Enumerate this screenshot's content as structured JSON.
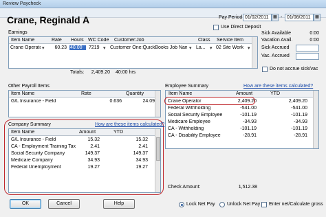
{
  "window": {
    "title": "Review Paycheck"
  },
  "employee": {
    "name": "Crane, Reginald A"
  },
  "pay_period": {
    "label": "Pay Period",
    "start": "01/02/2011",
    "dash": "-",
    "end": "01/08/2011",
    "direct_deposit_label": "Use Direct Deposit"
  },
  "earnings": {
    "section_label": "Earnings",
    "columns": [
      "Item Name",
      "Rate",
      "Hours",
      "WC Code",
      "Customer:Job",
      "Class",
      "Service Item"
    ],
    "row": {
      "item": "Crane Operator",
      "rate": "60.23",
      "hours": "40.00",
      "wc_code": "7219",
      "customer": "Customer One:QuickBooks Job Name",
      "class": "La...",
      "service_item": "02 Site Work"
    },
    "totals_label": "Totals:",
    "total_amount": "2,409.20",
    "total_hours": "40:00 hrs"
  },
  "sick_vac": {
    "sick_available": "Sick Available",
    "sick_available_val": "0:00",
    "vac_available": "Vacation Avail.",
    "vac_available_val": "0:00",
    "sick_accrued": "Sick Accrued",
    "sick_accrued_val": "",
    "vac_accrued": "Vac. Accrued",
    "vac_accrued_val": "",
    "no_accrue_label": "Do not accrue sick/vac"
  },
  "other_payroll": {
    "section_label": "Other Payroll Items",
    "columns": [
      "Item Name",
      "Rate",
      "Quantity"
    ],
    "row": {
      "item": "G/L Insurance - Field",
      "rate": "0.636",
      "quantity": "24.09"
    }
  },
  "employee_summary": {
    "section_label": "Employee Summary",
    "help_link": "How are these items calculated?",
    "columns": [
      "Item Name",
      "Amount",
      "YTD"
    ],
    "rows": [
      {
        "item": "Crane Operator",
        "amount": "2,409.20",
        "ytd": "2,409.20"
      },
      {
        "item": "Federal Withholding",
        "amount": "-541.00",
        "ytd": "-541.00"
      },
      {
        "item": "Social Security Employee",
        "amount": "-101.19",
        "ytd": "-101.19"
      },
      {
        "item": "Medicare Employee",
        "amount": "-34.93",
        "ytd": "-34.93"
      },
      {
        "item": "CA - Withholding",
        "amount": "-101.19",
        "ytd": "-101.19"
      },
      {
        "item": "CA - Disability Employee",
        "amount": "-28.91",
        "ytd": "-28.91"
      }
    ],
    "check_amount_label": "Check Amount:",
    "check_amount": "1,512.38"
  },
  "company_summary": {
    "section_label": "Company Summary",
    "help_link": "How are these items calculated?",
    "columns": [
      "Item Name",
      "Amount",
      "YTD"
    ],
    "rows": [
      {
        "item": "G/L Insurance - Field",
        "amount": "15.32",
        "ytd": "15.32"
      },
      {
        "item": "CA - Employment Training Tax",
        "amount": "2.41",
        "ytd": "2.41"
      },
      {
        "item": "Social Security Company",
        "amount": "149.37",
        "ytd": "149.37"
      },
      {
        "item": "Medicare Company",
        "amount": "34.93",
        "ytd": "34.93"
      },
      {
        "item": "Federal Unemployment",
        "amount": "19.27",
        "ytd": "19.27"
      }
    ]
  },
  "footer": {
    "ok": "OK",
    "cancel": "Cancel",
    "help": "Help",
    "lock_net_pay": "Lock Net Pay",
    "unlock_net_pay": "Unlock Net Pay",
    "enter_net": "Enter net/Calculate gross"
  },
  "colors": {
    "highlight": "#c0282d",
    "link": "#1a4aa8",
    "selection": "#3a6fc4"
  }
}
